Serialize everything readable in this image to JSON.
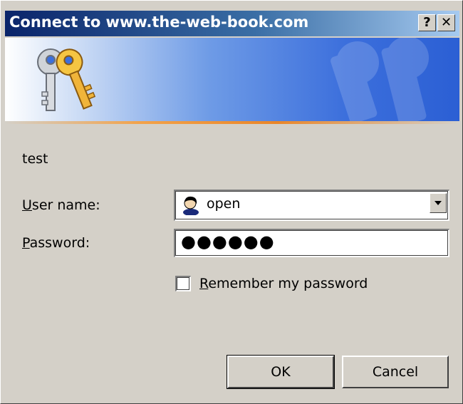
{
  "dialog": {
    "title": "Connect to www.the-web-book.com",
    "help_button": "?",
    "close_button": "✕",
    "realm": "test"
  },
  "form": {
    "username_label_u": "U",
    "username_label_rest": "ser name:",
    "username_value": "open",
    "password_label_u": "P",
    "password_label_rest": "assword:",
    "password_masked": "●●●●●●",
    "remember_label_u": "R",
    "remember_label_rest": "emember my password",
    "remember_checked": false
  },
  "buttons": {
    "ok": "OK",
    "cancel": "Cancel"
  },
  "icons": {
    "banner": "keys-icon",
    "user": "user-icon",
    "dropdown": "chevron-down-icon"
  },
  "colors": {
    "title_bar_start": "#0a246a",
    "title_bar_end": "#a6caf0",
    "dialog_bg": "#d4d0c8",
    "banner_accent": "#e9862a"
  }
}
